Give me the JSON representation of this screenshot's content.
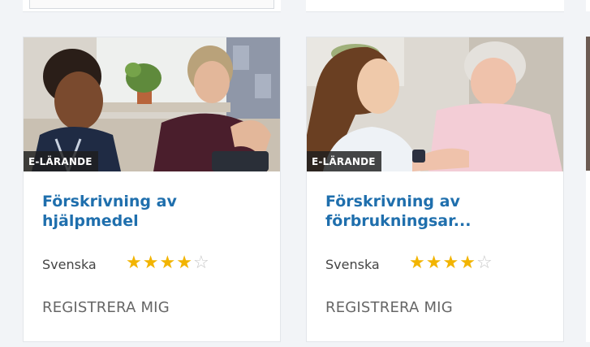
{
  "cards": [
    {
      "badge": "E-LÄRANDE",
      "title": "Förskrivning av hjälpmedel",
      "language": "Svenska",
      "rating": 4,
      "rating_max": 5,
      "register_label": "REGISTRERA MIG",
      "image": "photo-child-with-occupational-therapist"
    },
    {
      "badge": "E-LÄRANDE",
      "title": "Förskrivning av förbrukningsar...",
      "language": "Svenska",
      "rating": 4,
      "rating_max": 5,
      "register_label": "REGISTRERA MIG",
      "image": "photo-nurse-with-elderly-woman"
    }
  ],
  "colors": {
    "title": "#1f6fad",
    "star_filled": "#f2b400",
    "star_empty": "#c7c7c7",
    "badge_bg": "#1e1e1e",
    "page_bg": "#f2f4f7"
  }
}
